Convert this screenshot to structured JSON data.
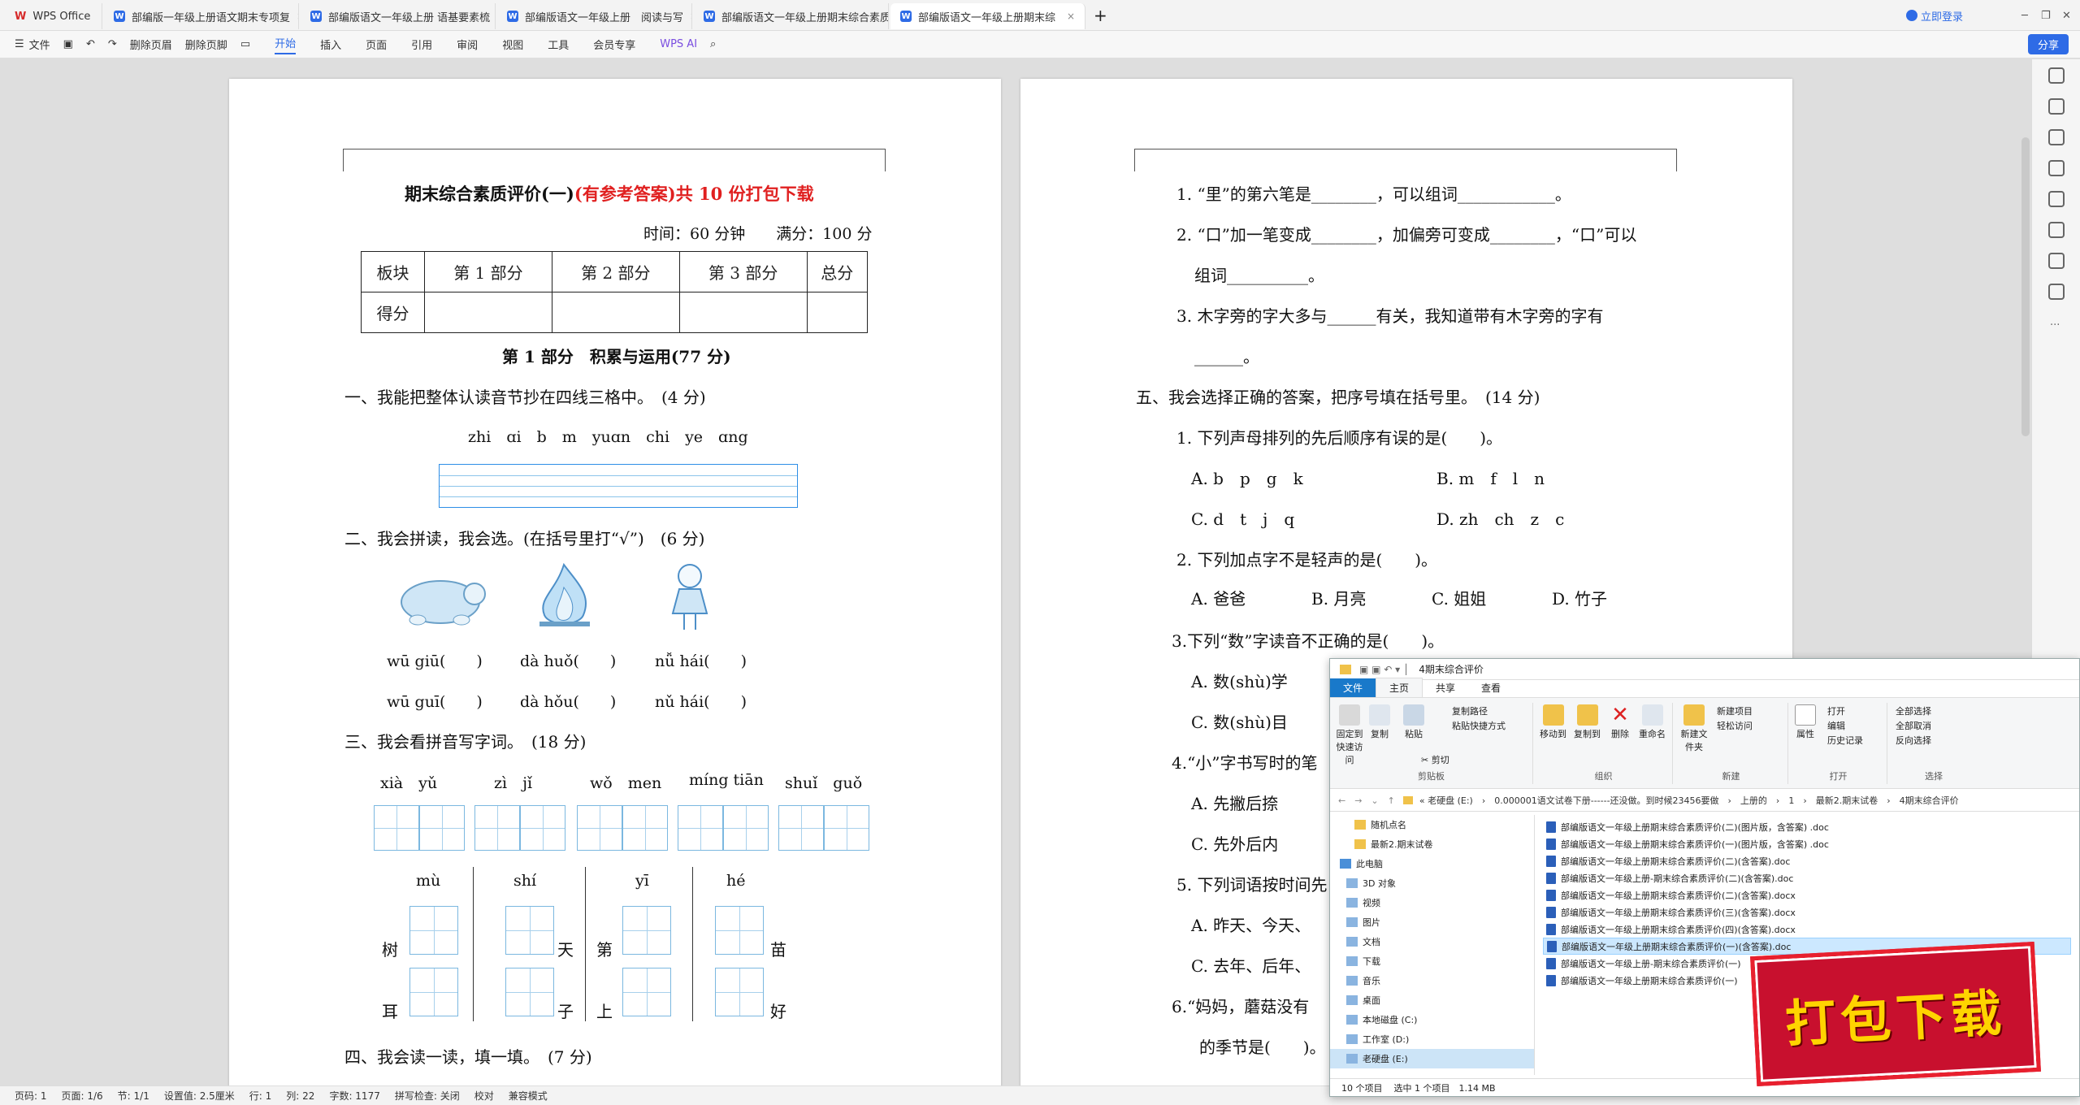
{
  "tabs": [
    {
      "label": "WPS Office"
    },
    {
      "label": "部编版一年级上册语文期末专项复"
    },
    {
      "label": "部编版语文一年级上册 语基要素梳"
    },
    {
      "label": "部编版语文一年级上册　阅读与写"
    },
    {
      "label": "部编版语文一年级上册期末综合素质"
    },
    {
      "label": "部编版语文一年级上册期末综"
    }
  ],
  "titlebar": {
    "login": "立即登录",
    "new_tab": "+"
  },
  "toolbar": {
    "file": "文件",
    "delete_header": "删除页眉",
    "delete_footer": "删除页脚",
    "menus": [
      "开始",
      "插入",
      "页面",
      "引用",
      "审阅",
      "视图",
      "工具",
      "会员专享"
    ],
    "wps_ai": "WPS AI",
    "share": "分享"
  },
  "left_page": {
    "title_black": "期末综合素质评价(一)",
    "title_red": "(有参考答案)共 10 份打包下载",
    "time": "时间：60 分钟　　满分：100 分",
    "table_row1": [
      "板块",
      "第 1 部分",
      "第 2 部分",
      "第 3 部分",
      "总分"
    ],
    "table_row2": [
      "得分",
      "",
      "",
      "",
      ""
    ],
    "section1_title": "第 1 部分　积累与运用(77 分)",
    "q1": "一、我能把整体认读音节抄在四线三格中。　(4 分)",
    "q1_syllables": "zhi　ɑi　b　m　yuɑn　chi　ye　ɑng",
    "q2": "二、我会拼读，我会选。(在括号里打“√”)　(6 分)",
    "q2_row1": [
      "wū giū(　　)",
      "dà huǒ(　　)",
      "nǚ hái(　　)"
    ],
    "q2_row2": [
      "wū guī(　　)",
      "dà hǒu(　　)",
      "nǔ hái(　　)"
    ],
    "q3": "三、我会看拼音写字词。　(18 分)",
    "q3_pinyin": [
      "xià　yǔ",
      "zì　jǐ",
      "wǒ　men",
      "míng tiān",
      "shuǐ　guǒ"
    ],
    "q3_part2_pinyin": [
      "mù",
      "shí",
      "yī",
      "hé"
    ],
    "q3_part2_chars_top": [
      "树",
      "天",
      "第",
      "苗"
    ],
    "q3_part2_chars_bottom": [
      "耳",
      "子",
      "上",
      "好"
    ],
    "q4": "四、我会读一读，填一填。　(7 分)"
  },
  "right_page": {
    "lines": [
      "1. “里”的第六笔是________，可以组词____________。",
      "2. “口”加一笔变成________，加偏旁可变成________，“口”可以",
      "组词__________。",
      "3. 木字旁的字大多与______有关，我知道带有木字旁的字有",
      "______。",
      "五、我会选择正确的答案，把序号填在括号里。　(14 分)",
      "1. 下列声母排列的先后顺序有误的是(　　)。",
      "A. b　p　g　k",
      "B. m　f　l　n",
      "C. d　t　j　q",
      "D. zh　ch　z　c",
      "2. 下列加点字不是轻声的是(　　)。",
      "A. 爸爸",
      "B. 月亮",
      "C. 姐姐",
      "D. 竹子",
      "3.下列“数”字读音不正确的是(　　)。",
      "A. 数(shù)学",
      "C. 数(shù)目",
      "4.“小”字书写时的笔",
      "A. 先撇后捺",
      "C. 先外后内",
      "5. 下列词语按时间先",
      "A. 昨天、今天、",
      "C. 去年、后年、",
      "6.“妈妈，蘑菇没有",
      "的季节是(　　)。"
    ]
  },
  "status": {
    "page_no": "页码: 1",
    "pages": "页面: 1/6",
    "section": "节: 1/1",
    "setting": "设置值: 2.5厘米",
    "row": "行: 1",
    "col": "列: 22",
    "words": "字数: 1177",
    "spell": "拼写检查: 关闭",
    "proof": "校对",
    "compat": "兼容模式"
  },
  "explorer": {
    "title": "4期末综合评价",
    "tabs": [
      "文件",
      "主页",
      "共享",
      "查看"
    ],
    "ribbon": {
      "pin": "固定到快速访问",
      "copy": "复制",
      "paste": "粘贴",
      "copy_path": "复制路径",
      "paste_shortcut": "粘贴快捷方式",
      "cut": "剪切",
      "clipboard": "剪贴板",
      "move_to": "移动到",
      "copy_to": "复制到",
      "delete": "删除",
      "rename": "重命名",
      "organize": "组织",
      "new_folder": "新建文件夹",
      "new_item": "新建项目",
      "easy_access": "轻松访问",
      "new": "新建",
      "properties": "属性",
      "open": "打开",
      "edit": "编辑",
      "history": "历史记录",
      "open_group": "打开",
      "select_all": "全部选择",
      "select_none": "全部取消",
      "invert": "反向选择",
      "select": "选择"
    },
    "address": "« 老硬盘 (E:)　›　0.000001语文试卷下册------还没做。到时候23456要做　›　上册的　›　1　›　最新2.期末试卷　›　4期末综合评价",
    "nav": [
      "随机点名",
      "最新2.期末试卷",
      "此电脑",
      "3D 对象",
      "视频",
      "图片",
      "文档",
      "下载",
      "音乐",
      "桌面",
      "本地磁盘 (C:)",
      "工作室 (D:)",
      "老硬盘 (E:)"
    ],
    "files": [
      "部编版语文一年级上册期末综合素质评价(二)(图片版，含答案) .doc",
      "部编版语文一年级上册期末综合素质评价(一)(图片版，含答案) .doc",
      "部编版语文一年级上册期末综合素质评价(二)(含答案).doc",
      "部编版语文一年级上册-期末综合素质评价(二)(含答案).doc",
      "部编版语文一年级上册期末综合素质评价(二)(含答案).docx",
      "部编版语文一年级上册期末综合素质评价(三)(含答案).docx",
      "部编版语文一年级上册期末综合素质评价(四)(含答案).docx",
      "部编版语文一年级上册期末综合素质评价(一)(含答案).doc",
      "部编版语文一年级上册-期末综合素质评价(一)",
      "部编版语文一年级上册期末综合素质评价(一)"
    ],
    "status_items": "10 个项目",
    "status_selected": "选中 1 个项目　1.14 MB"
  },
  "promo": "打包下载"
}
